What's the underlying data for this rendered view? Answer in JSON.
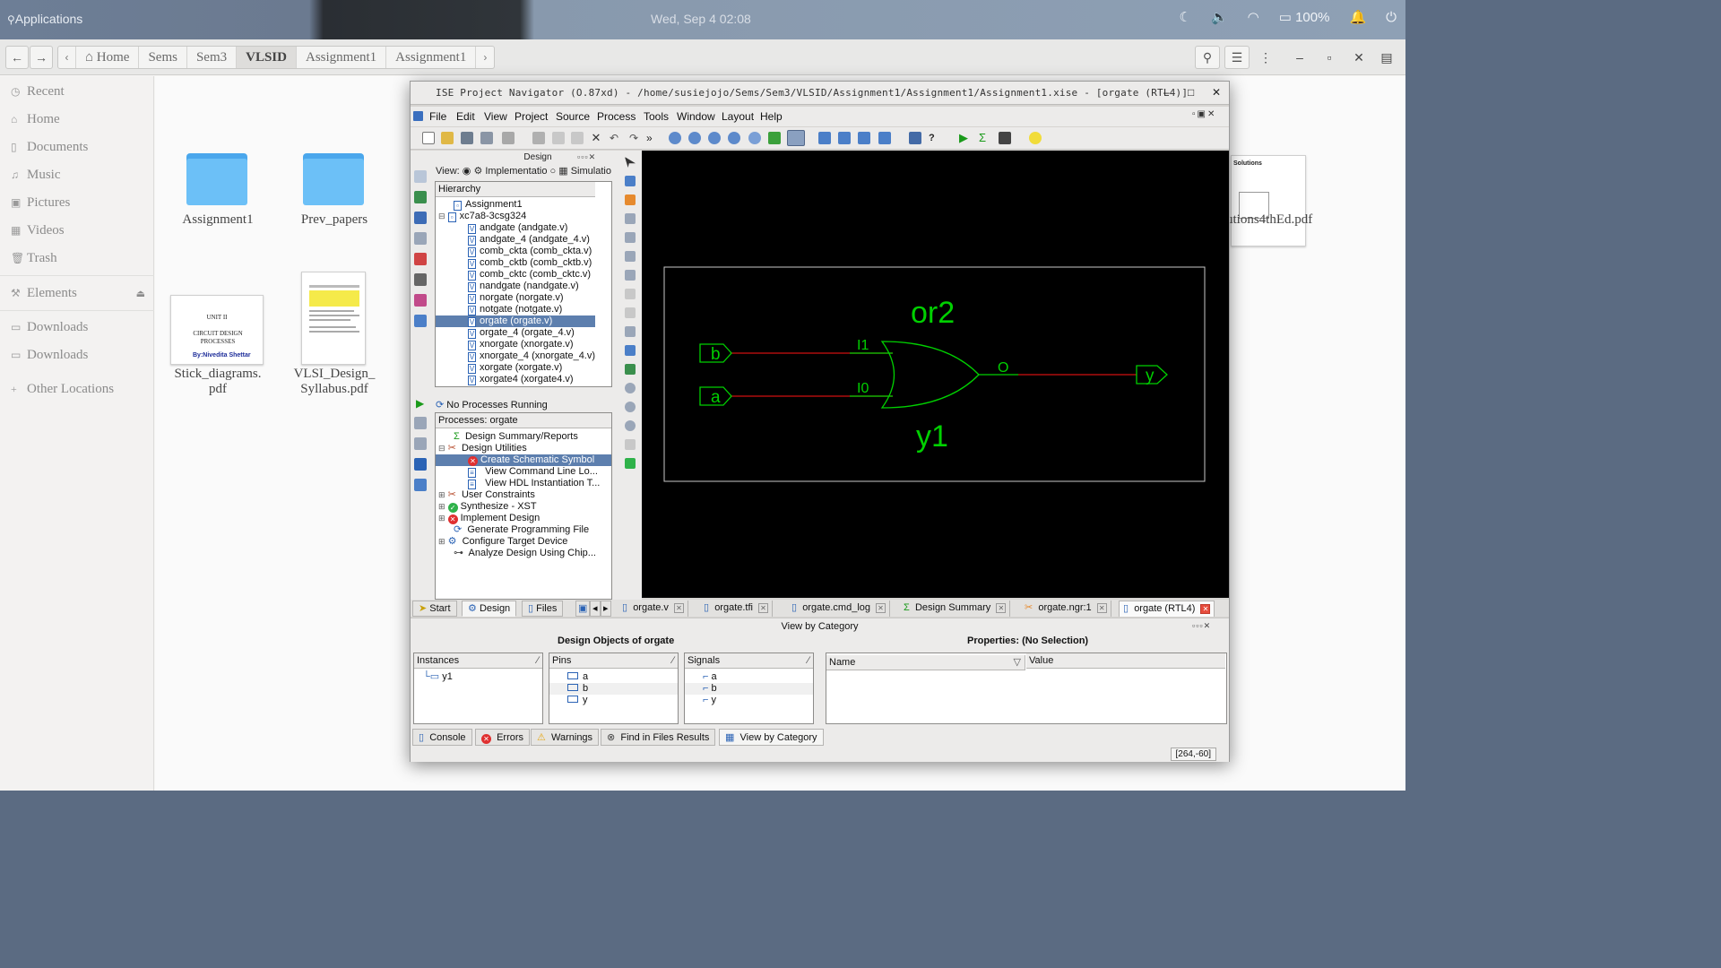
{
  "top_panel": {
    "apps_label": "Applications",
    "clock": "Wed, Sep  4  02:08",
    "battery": "100%"
  },
  "files": {
    "breadcrumbs": [
      "Home",
      "Sems",
      "Sem3",
      "VLSID",
      "Assignment1",
      "Assignment1"
    ],
    "active_crumb": "VLSID",
    "sidebar": {
      "places": [
        "Recent",
        "Home",
        "Documents",
        "Music",
        "Pictures",
        "Videos",
        "Trash"
      ],
      "elements": "Elements",
      "downloads": [
        "Downloads",
        "Downloads"
      ],
      "other": "Other Locations"
    },
    "items": [
      {
        "name": "Assignment1",
        "type": "folder"
      },
      {
        "name": "Prev_papers",
        "type": "folder"
      },
      {
        "name": "Stick_diagrams.\npdf",
        "type": "pdf"
      },
      {
        "name": "VLSI_Design_\nSyllabus.pdf",
        "type": "pdf"
      },
      {
        "name": "utions4thEd.pdf",
        "type": "pdf"
      }
    ],
    "thumb_text": {
      "unit": "UNIT II",
      "title": "CIRCUIT DESIGN PROCESSES",
      "author": "By:Nivedita Shettar",
      "solutions": "Solutions"
    }
  },
  "ise": {
    "title": "ISE Project Navigator (O.87xd) - /home/susiejojo/Sems/Sem3/VLSID/Assignment1/Assignment1/Assignment1.xise - [orgate (RTL4)]",
    "menu": [
      "File",
      "Edit",
      "View",
      "Project",
      "Source",
      "Process",
      "Tools",
      "Window",
      "Layout",
      "Help"
    ],
    "design_pane": {
      "title": "Design",
      "view_label": "View:",
      "implementation": "Implementatio",
      "simulation": "Simulatio",
      "hierarchy_header": "Hierarchy",
      "project": "Assignment1",
      "device": "xc7a8-3csg324",
      "sources": [
        "andgate (andgate.v)",
        "andgate_4 (andgate_4.v)",
        "comb_ckta (comb_ckta.v)",
        "comb_cktb (comb_cktb.v)",
        "comb_cktc (comb_cktc.v)",
        "nandgate (nandgate.v)",
        "norgate (norgate.v)",
        "notgate (notgate.v)",
        "orgate (orgate.v)",
        "orgate_4 (orgate_4.v)",
        "xnorgate (xnorgate.v)",
        "xnorgate_4 (xnorgate_4.v)",
        "xorgate (xorgate.v)",
        "xorgate4 (xorgate4.v)"
      ],
      "selected_source": "orgate (orgate.v)",
      "process_status": "No Processes Running",
      "processes_header": "Processes: orgate",
      "processes": [
        {
          "label": "Design Summary/Reports",
          "indent": 1
        },
        {
          "label": "Design Utilities",
          "indent": 1
        },
        {
          "label": "Create Schematic Symbol",
          "indent": 2,
          "selected": true
        },
        {
          "label": "View Command Line Lo...",
          "indent": 2
        },
        {
          "label": "View HDL Instantiation T...",
          "indent": 2
        },
        {
          "label": "User Constraints",
          "indent": 1
        },
        {
          "label": "Synthesize - XST",
          "indent": 1
        },
        {
          "label": "Implement Design",
          "indent": 1
        },
        {
          "label": "Generate Programming File",
          "indent": 1
        },
        {
          "label": "Configure Target Device",
          "indent": 1
        },
        {
          "label": "Analyze Design Using Chip...",
          "indent": 1
        }
      ],
      "tabs": [
        "Start",
        "Design",
        "Files"
      ]
    },
    "schematic": {
      "cell_name": "or2",
      "instance_name": "y1",
      "inputs": [
        "b",
        "a"
      ],
      "output": "y",
      "pin_inputs": [
        "I1",
        "I0"
      ],
      "pin_output": "O",
      "colors": {
        "background": "#000000",
        "symbol": "#00d000",
        "wire": "#d01010",
        "frame": "#c8c8c8"
      }
    },
    "doc_tabs": [
      "orgate.v",
      "orgate.tfi",
      "orgate.cmd_log",
      "Design Summary",
      "orgate.ngr:1",
      "orgate (RTL4)"
    ],
    "bottom": {
      "header": "View by Category",
      "design_objects_title": "Design Objects of orgate",
      "properties_title": "Properties: (No Selection)",
      "instances_header": "Instances",
      "instances": [
        "y1"
      ],
      "pins_header": "Pins",
      "pins": [
        "a",
        "b",
        "y"
      ],
      "signals_header": "Signals",
      "signals": [
        "a",
        "b",
        "y"
      ],
      "prop_name": "Name",
      "prop_value": "Value",
      "console_tabs": [
        "Console",
        "Errors",
        "Warnings",
        "Find in Files Results",
        "View by Category"
      ],
      "coords": "[264,-60]"
    }
  }
}
